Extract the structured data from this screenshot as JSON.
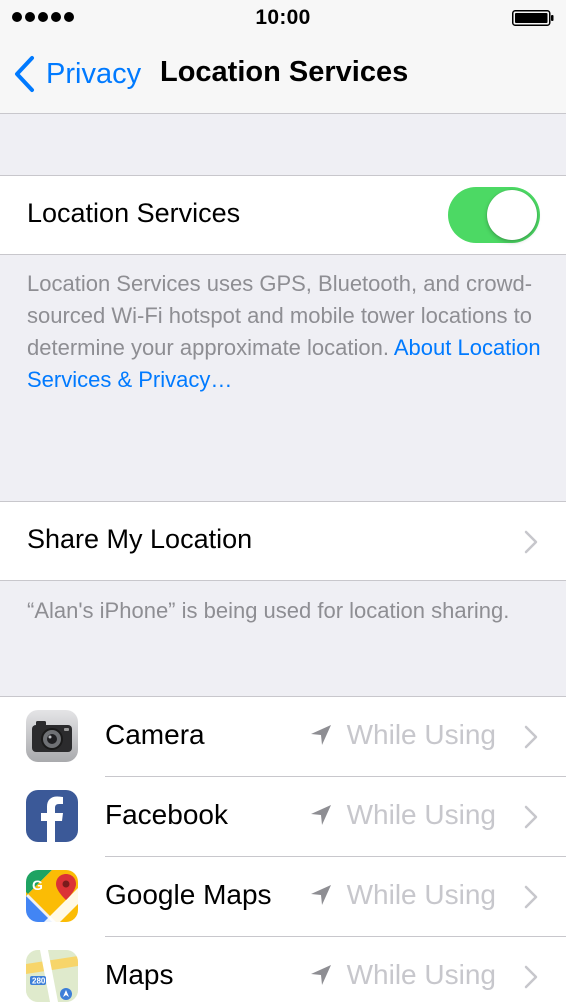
{
  "status_bar": {
    "time": "10:00"
  },
  "nav": {
    "back_label": "Privacy",
    "title": "Location Services"
  },
  "location_services": {
    "label": "Location Services",
    "enabled": true
  },
  "location_footer": {
    "text": "Location Services uses GPS, Bluetooth, and crowd-sourced Wi-Fi hotspot and mobile tower locations to determine your approximate location. ",
    "link": "About Location Services & Privacy…"
  },
  "share_location": {
    "label": "Share My Location"
  },
  "share_footer": {
    "text": "“Alan's iPhone” is being used for location sharing."
  },
  "apps": [
    {
      "name": "Camera",
      "status": "While Using",
      "icon": "camera-icon"
    },
    {
      "name": "Facebook",
      "status": "While Using",
      "icon": "facebook-icon"
    },
    {
      "name": "Google Maps",
      "status": "While Using",
      "icon": "google-maps-icon"
    },
    {
      "name": "Maps",
      "status": "While Using",
      "icon": "maps-icon"
    }
  ],
  "colors": {
    "accent": "#007aff",
    "toggle_on": "#4cd964",
    "background": "#efeff4",
    "secondary_text": "#8e8e93",
    "value_text": "#c7c7cc"
  }
}
